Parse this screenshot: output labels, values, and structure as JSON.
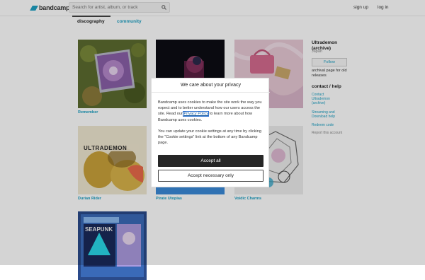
{
  "header": {
    "logo_text": "bandcamp",
    "search_placeholder": "Search for artist, album, or track",
    "signup_label": "sign up",
    "login_label": "log in",
    "brand_color": "#1da0c3"
  },
  "tabs": [
    {
      "label": "discography",
      "active": true
    },
    {
      "label": "community",
      "active": false
    }
  ],
  "albums": [
    {
      "title": "Remember"
    },
    {
      "title": ""
    },
    {
      "title": ""
    },
    {
      "title": "Durian Rider"
    },
    {
      "title": "Pirate Utopias"
    },
    {
      "title": "Voidic Charms"
    },
    {
      "title": ""
    }
  ],
  "sidebar": {
    "artist_name": "Ultrademon (archive)",
    "location": "Japan",
    "follow_label": "Follow",
    "archival_note": "archival page for old releases",
    "contact_heading": "contact / help",
    "links": [
      "Contact Ultrademon (archive)",
      "Streaming and Download help",
      "Redeem code",
      "Report this account"
    ]
  },
  "cookie_dialog": {
    "title": "We care about your privacy",
    "para1_before": "Bandcamp uses cookies to make the site work the way you expect and to better understand how our users access the site. Read our ",
    "privacy_link": "Privacy Policy",
    "para1_after": " to learn more about how Bandcamp uses cookies.",
    "para2": "You can update your cookie settings at any time by clicking the “Cookie settings” link at the bottom of any Bandcamp page.",
    "accept_all_label": "Accept all",
    "accept_necessary_label": "Accept necessary only"
  }
}
